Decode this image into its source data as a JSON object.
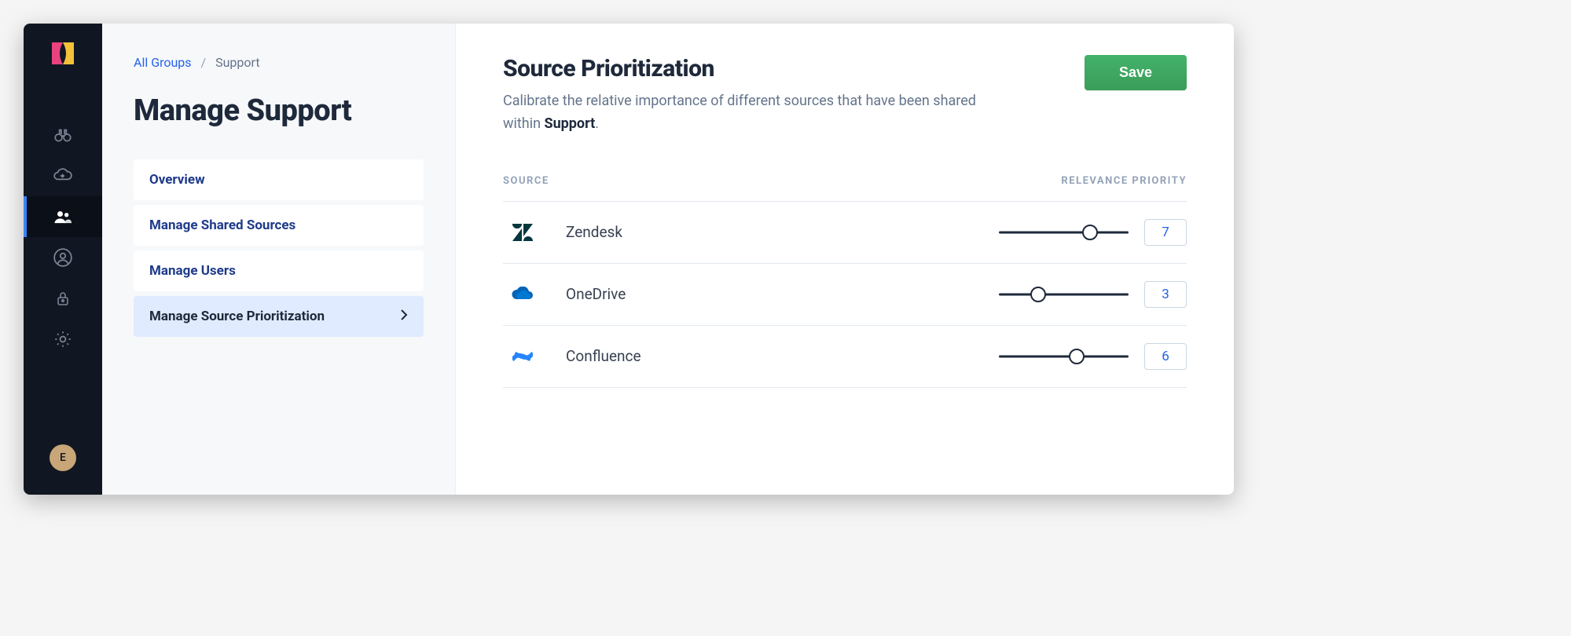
{
  "rail": {
    "avatar_initial": "E"
  },
  "breadcrumb": {
    "root": "All Groups",
    "current": "Support"
  },
  "page_title": "Manage Support",
  "nav": {
    "items": [
      {
        "label": "Overview"
      },
      {
        "label": "Manage Shared Sources"
      },
      {
        "label": "Manage Users"
      },
      {
        "label": "Manage Source Prioritization",
        "active": true
      }
    ]
  },
  "main": {
    "title": "Source Prioritization",
    "desc_prefix": "Calibrate the relative importance of different sources that have been shared within ",
    "group_name": "Support",
    "desc_suffix": ".",
    "save_label": "Save",
    "col_source": "SOURCE",
    "col_priority": "RELEVANCE PRIORITY",
    "slider_max": 10,
    "sources": [
      {
        "name": "Zendesk",
        "icon": "zendesk",
        "value": 7
      },
      {
        "name": "OneDrive",
        "icon": "onedrive",
        "value": 3
      },
      {
        "name": "Confluence",
        "icon": "confluence",
        "value": 6
      }
    ]
  }
}
